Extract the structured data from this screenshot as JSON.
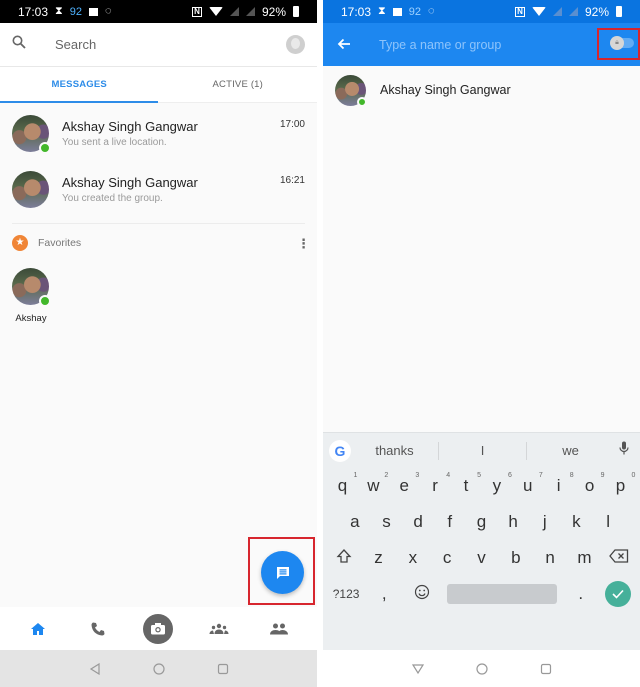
{
  "left_screen": {
    "status_bar": {
      "time": "17:03",
      "notif_count": "92",
      "battery": "92%",
      "icons_left": [
        "hourglass-icon",
        "image-icon",
        "messenger-icon"
      ],
      "icons_right": [
        "nfc-icon",
        "wifi-icon",
        "signal-icon",
        "signal-icon",
        "battery-icon"
      ]
    },
    "search": {
      "placeholder": "Search"
    },
    "tabs": [
      {
        "label": "MESSAGES",
        "active": true
      },
      {
        "label": "ACTIVE (1)",
        "active": false
      }
    ],
    "conversations": [
      {
        "name": "Akshay Singh Gangwar",
        "preview": "You sent a live location.",
        "time": "17:00",
        "online": true
      },
      {
        "name": "Akshay Singh Gangwar",
        "preview": "You created the group.",
        "time": "16:21",
        "online": false
      }
    ],
    "favorites": {
      "label": "Favorites",
      "items": [
        {
          "name": "Akshay",
          "online": true
        }
      ]
    },
    "fab": {
      "icon": "new-message-icon",
      "highlight_color": "#d7262e"
    },
    "bottom_nav": [
      "home-icon",
      "phone-icon",
      "camera-icon",
      "groups-icon",
      "people-icon"
    ],
    "accent_color": "#1d87f0"
  },
  "right_screen": {
    "status_bar": {
      "time": "17:03",
      "notif_count": "92",
      "battery": "92%"
    },
    "to_field": {
      "placeholder": "Type a name or group",
      "value": ""
    },
    "secret_toggle": {
      "on": false,
      "icon": "lock-icon"
    },
    "contacts": [
      {
        "name": "Akshay Singh Gangwar",
        "online": true
      }
    ],
    "keyboard": {
      "suggestions": [
        "thanks",
        "I",
        "we"
      ],
      "row1": [
        {
          "k": "q",
          "n": "1"
        },
        {
          "k": "w",
          "n": "2"
        },
        {
          "k": "e",
          "n": "3"
        },
        {
          "k": "r",
          "n": "4"
        },
        {
          "k": "t",
          "n": "5"
        },
        {
          "k": "y",
          "n": "6"
        },
        {
          "k": "u",
          "n": "7"
        },
        {
          "k": "i",
          "n": "8"
        },
        {
          "k": "o",
          "n": "9"
        },
        {
          "k": "p",
          "n": "0"
        }
      ],
      "row2": [
        "a",
        "s",
        "d",
        "f",
        "g",
        "h",
        "j",
        "k",
        "l"
      ],
      "row3": [
        "z",
        "x",
        "c",
        "v",
        "b",
        "n",
        "m"
      ],
      "symbols_key": "?123",
      "comma": ",",
      "period": "."
    }
  }
}
